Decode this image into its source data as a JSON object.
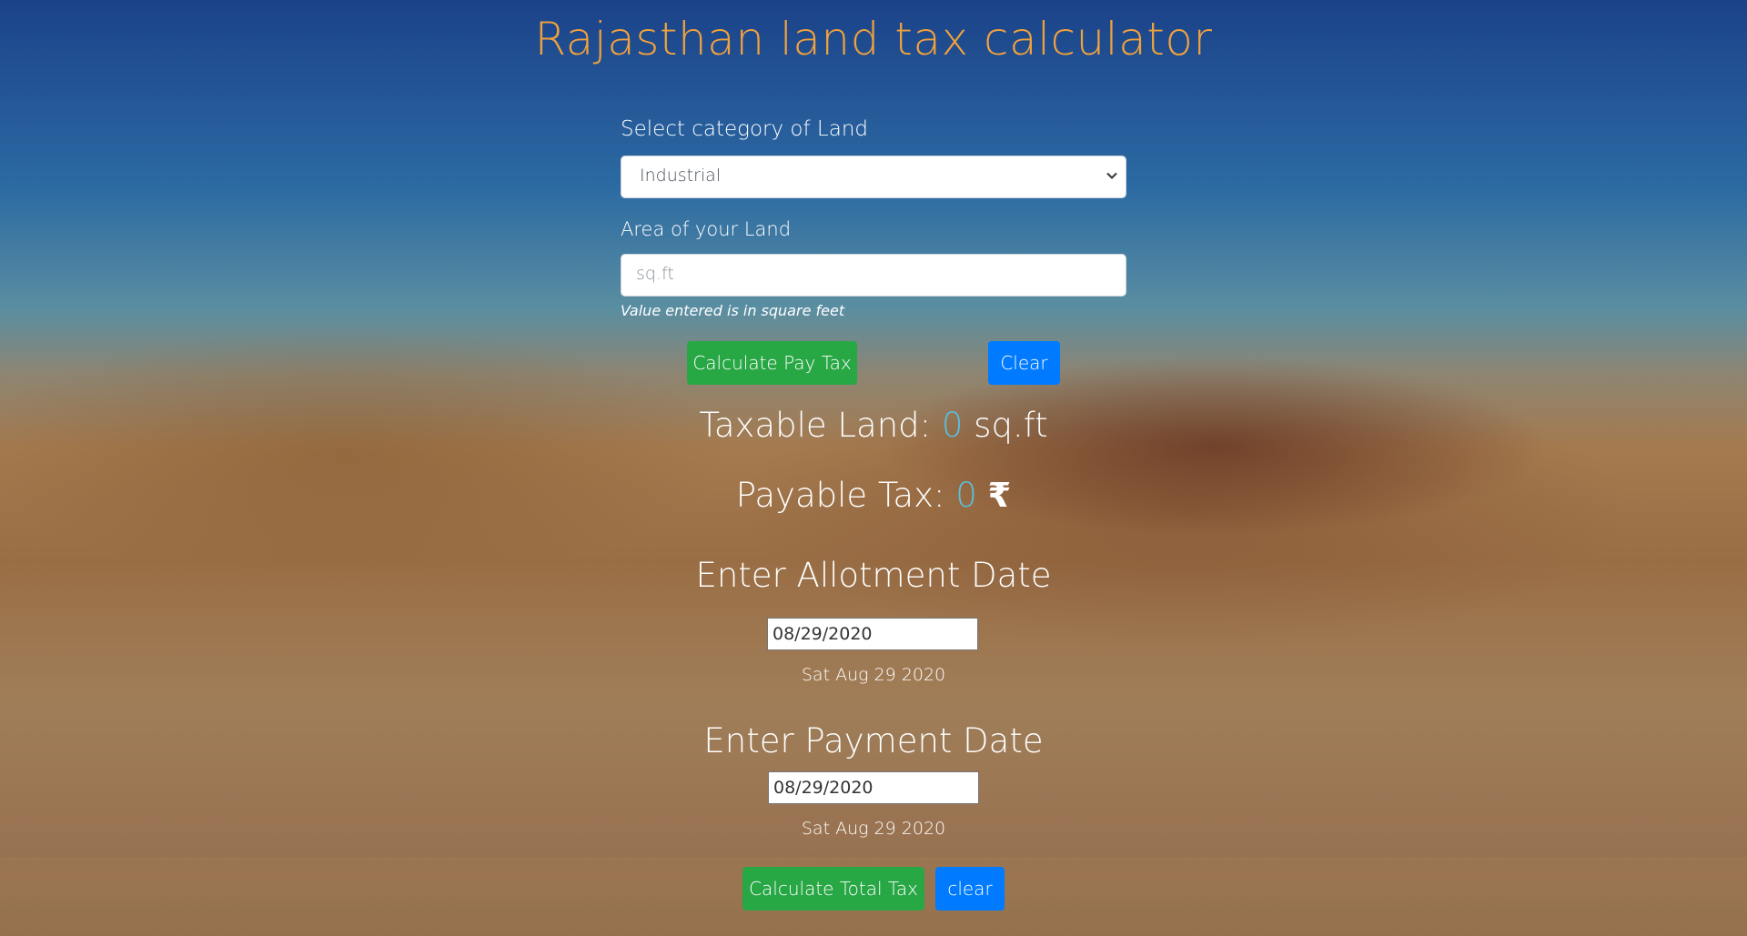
{
  "header": {
    "title": "Rajasthan land tax calculator"
  },
  "land_form": {
    "category_label": "Select category of Land",
    "category_selected": "Industrial",
    "area_label": "Area of your Land",
    "area_placeholder": "sq.ft",
    "area_value": "",
    "area_hint": "Value entered is in square feet",
    "calculate_button": "Calculate Pay Tax",
    "clear_button": "Clear"
  },
  "results": {
    "taxable_label": "Taxable Land:",
    "taxable_value": "0",
    "taxable_unit": "sq.ft",
    "payable_label": "Payable Tax:",
    "payable_value": "0",
    "payable_unit": "₹"
  },
  "allotment": {
    "heading": "Enter Allotment Date",
    "date_value": "08/29/2020",
    "date_display": "Sat Aug 29 2020"
  },
  "payment": {
    "heading": "Enter Payment Date",
    "date_value": "08/29/2020",
    "date_display": "Sat Aug 29 2020"
  },
  "total": {
    "calculate_button": "Calculate Total Tax",
    "clear_button": "clear"
  },
  "colors": {
    "title": "#f0a13d",
    "success_button": "#28a745",
    "primary_button": "#007bff",
    "result_number": "#5bc0de"
  },
  "icons": {
    "select_arrow": "chevron-down-icon"
  }
}
